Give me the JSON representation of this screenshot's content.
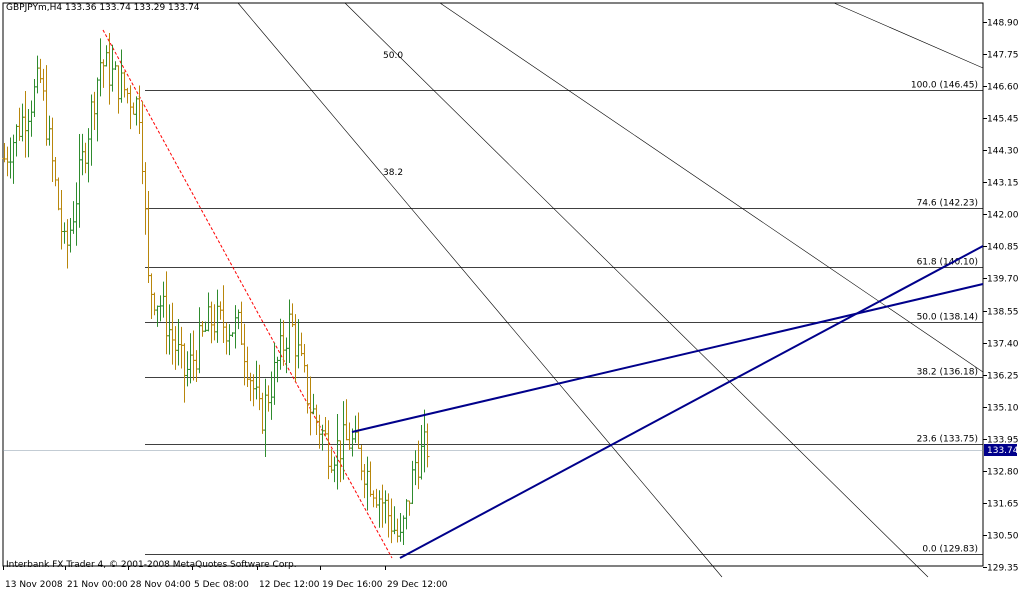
{
  "header": {
    "symbol": "GBPJPYm,H4",
    "ohlc": "133.36 133.74 133.29 133.74"
  },
  "footer": {
    "copyright": "Interbank FX Trader 4, © 2001-2008 MetaQuotes Software Corp."
  },
  "chart_data": {
    "type": "ohlc",
    "current_price": "133.74",
    "y_ticks": [
      "148.90",
      "147.75",
      "146.60",
      "145.45",
      "144.30",
      "143.15",
      "142.00",
      "140.85",
      "139.70",
      "138.55",
      "137.40",
      "136.25",
      "135.10",
      "133.95",
      "132.80",
      "131.65",
      "130.50",
      "129.35"
    ],
    "ylim": [
      129.35,
      149.8
    ],
    "x_ticks": [
      "13 Nov 2008",
      "21 Nov 00:00",
      "28 Nov 04:00",
      "5 Dec 08:00",
      "12 Dec 12:00",
      "19 Dec 16:00",
      "29 Dec 12:00"
    ],
    "fib_levels": [
      {
        "label": "100.0",
        "value": "(146.45)",
        "price": 146.45
      },
      {
        "label": "74.6",
        "value": "(142.23)",
        "price": 142.23
      },
      {
        "label": "61.8",
        "value": "(140.10)",
        "price": 140.1
      },
      {
        "label": "50.0",
        "value": "(138.14)",
        "price": 138.14
      },
      {
        "label": "38.2",
        "value": "(136.18)",
        "price": 136.18
      },
      {
        "label": "23.6",
        "value": "(133.75)",
        "price": 133.75
      },
      {
        "label": "0.0",
        "value": "(129.83)",
        "price": 129.83
      }
    ],
    "fan_labels": [
      "50.0",
      "38.2"
    ],
    "colors": {
      "bull": "#2e8b2e",
      "bear": "#b8860b",
      "trend": "#00008b",
      "trend_dotted": "#ff0000",
      "fib": "#000000",
      "fan": "#000000",
      "price_box": "#00008b"
    }
  }
}
